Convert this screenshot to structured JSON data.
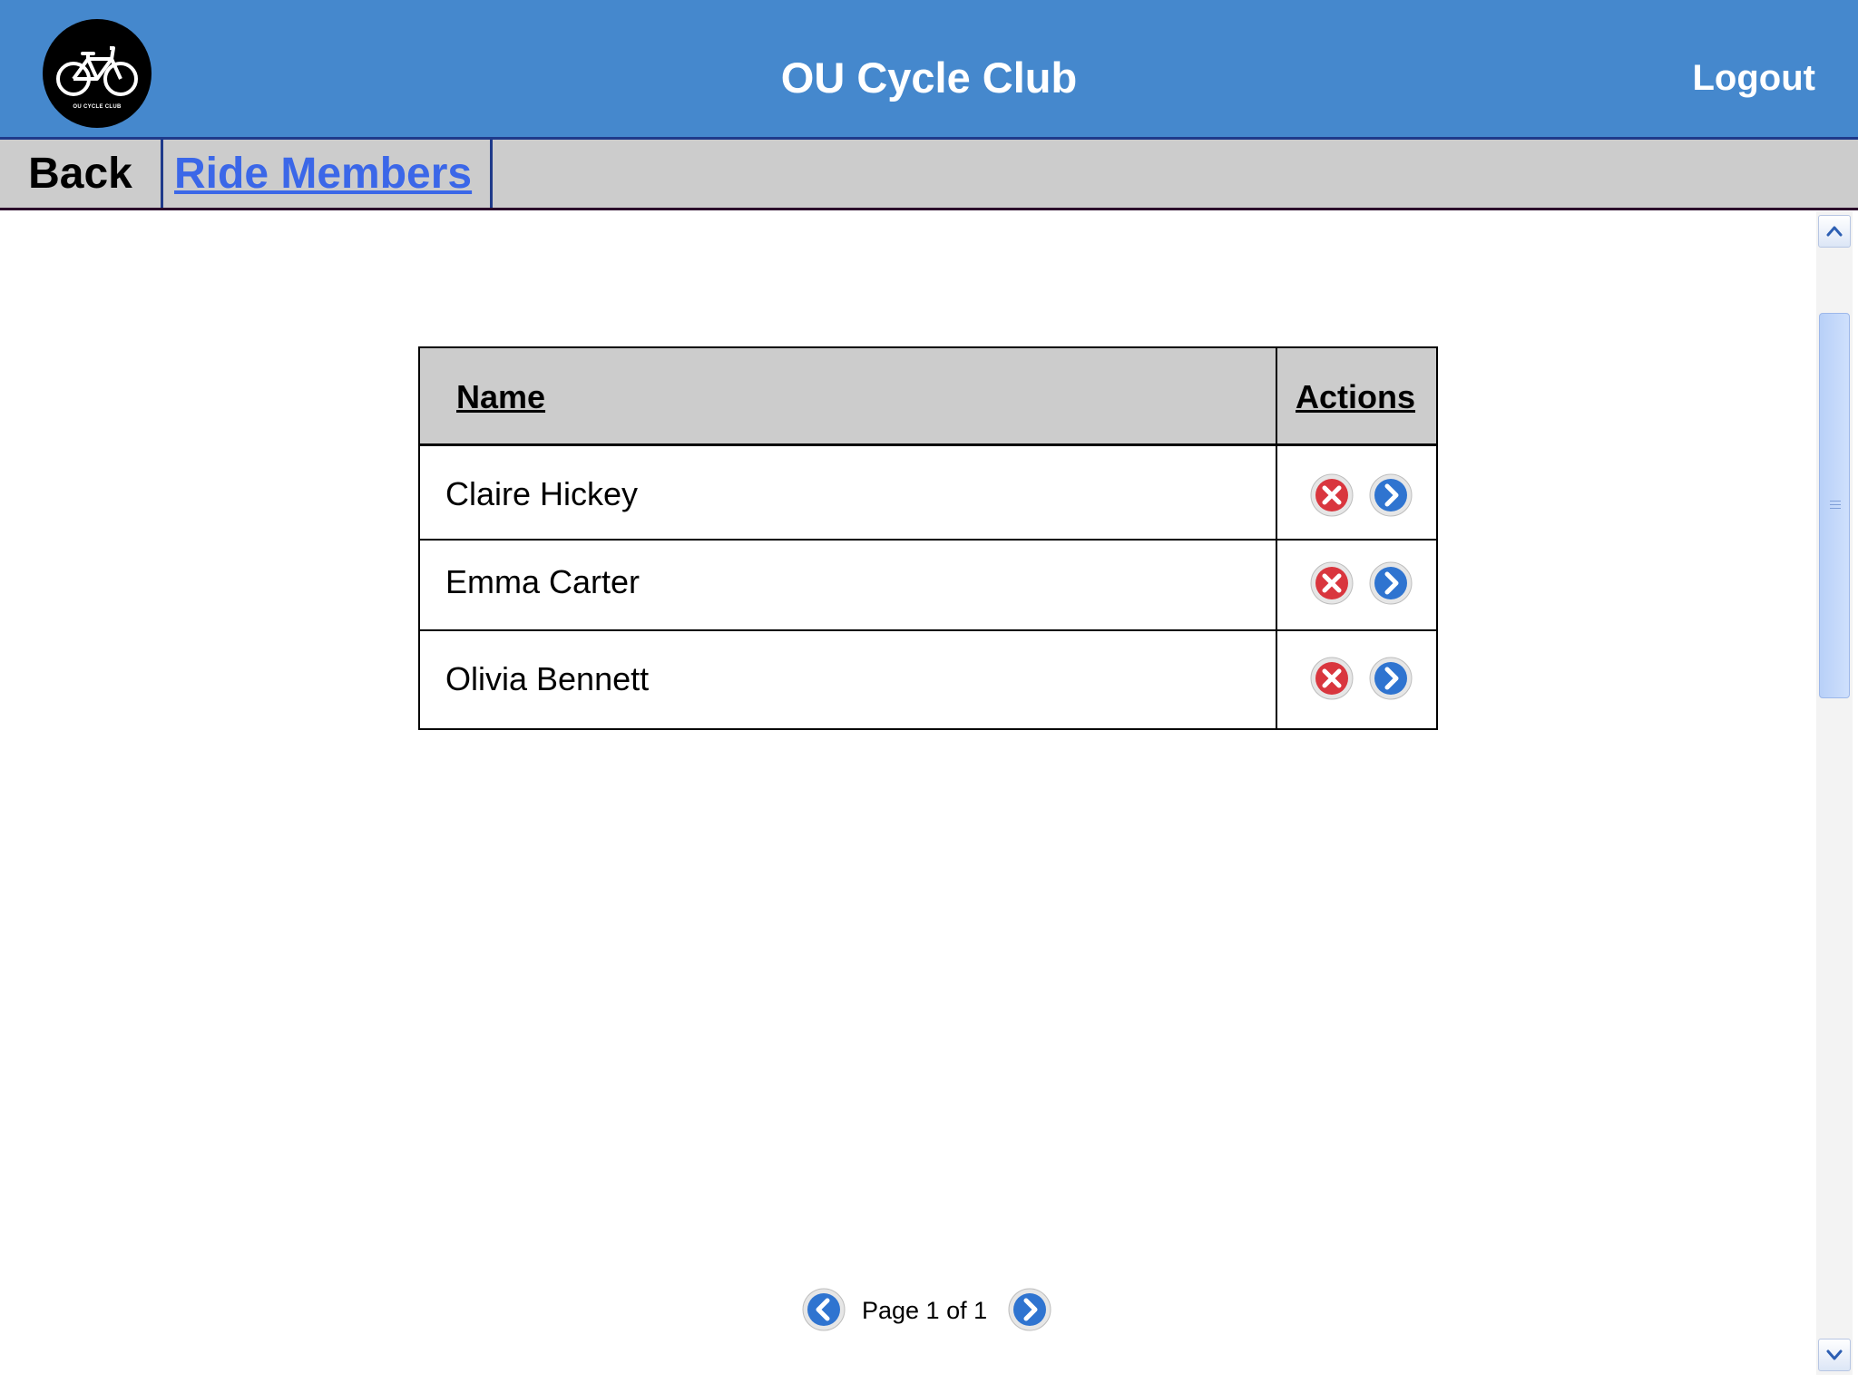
{
  "header": {
    "logo_text": "OU CYCLE CLUB",
    "title": "OU Cycle Club",
    "logout_label": "Logout"
  },
  "nav": {
    "back_label": "Back",
    "current_label": "Ride Members"
  },
  "table": {
    "columns": [
      "Name",
      "Actions"
    ],
    "rows": [
      {
        "name": "Claire Hickey"
      },
      {
        "name": "Emma Carter"
      },
      {
        "name": "Olivia Bennett"
      }
    ],
    "row_actions": [
      "remove-icon",
      "chevron-right-icon"
    ]
  },
  "pager": {
    "label": "Page 1 of 1",
    "prev_icon": "chevron-left-icon",
    "next_icon": "chevron-right-icon"
  },
  "colors": {
    "header_bg": "#4588cd",
    "nav_bg": "#cccccc",
    "link": "#3b67e8",
    "remove": "#d9363e",
    "go": "#2f74d0"
  }
}
